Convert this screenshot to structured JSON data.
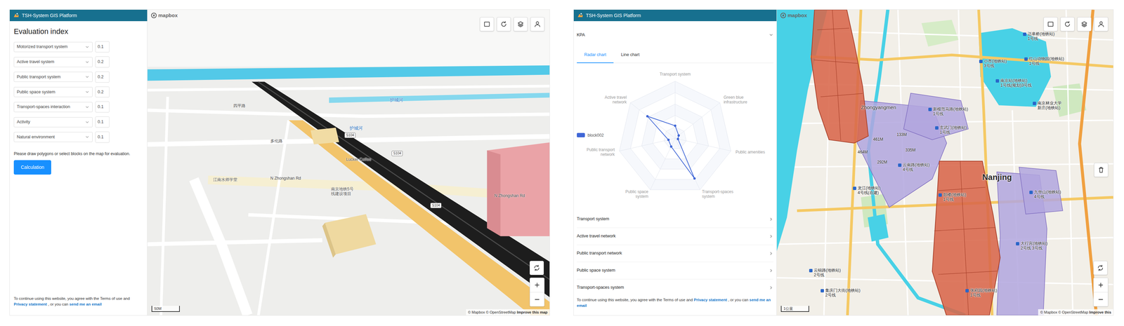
{
  "evaluation_window": {
    "app_title": "TSH-System GIS Platform",
    "sidebar": {
      "heading": "Evaluation index",
      "indexes": [
        {
          "label": "Motorized transport system",
          "weight": "0.1"
        },
        {
          "label": "Active travel system",
          "weight": "0.2"
        },
        {
          "label": "Public transport system",
          "weight": "0.2"
        },
        {
          "label": "Public space system",
          "weight": "0.2"
        },
        {
          "label": "Transport-spaces interaction",
          "weight": "0.1"
        },
        {
          "label": "Activity",
          "weight": "0.1"
        },
        {
          "label": "Natural environment",
          "weight": "0.1"
        }
      ],
      "hint": "Please draw polygons or select blocks on the map for evaluation.",
      "button": "Calculation"
    },
    "footer": {
      "lead": "To continue using this website, you agree with the Terms of use and",
      "privacy": "Privacy statement",
      "middle": ", or you can",
      "email": "send me an email"
    },
    "map": {
      "logo": "mapbox",
      "scale": "50M",
      "attribution": {
        "mapbox": "© Mapbox",
        "osm": "© OpenStreetMap",
        "improve": "Improve this map"
      },
      "labels": [
        {
          "text": "护城河",
          "kind": "water"
        },
        {
          "text": "护城河",
          "kind": "water"
        },
        {
          "text": "四平路",
          "kind": "road"
        },
        {
          "text": "多伦路",
          "kind": "road"
        },
        {
          "text": "N Zhongshan Rd",
          "kind": "road"
        },
        {
          "text": "N Zhongshan Rd",
          "kind": "road"
        },
        {
          "text": "Lucker Coffee",
          "kind": "poi"
        },
        {
          "text": "江南水师学堂",
          "kind": "poi"
        },
        {
          "text": "南京地铁5号\n线建设项目",
          "kind": "poi"
        },
        {
          "text": "S104",
          "kind": "shield"
        },
        {
          "text": "S104",
          "kind": "shield"
        },
        {
          "text": "S104",
          "kind": "shield"
        }
      ]
    }
  },
  "kpa_window": {
    "app_title": "TSH-System GIS Platform",
    "panel": {
      "title": "KPA",
      "expanded": true,
      "tabs": [
        {
          "label": "Radar chart",
          "selected": true
        },
        {
          "label": "Line chart",
          "selected": false
        }
      ],
      "chart": {
        "axes": [
          "Transport system",
          "Green blue infrastructure",
          "Public amenities",
          "Transport-spaces system",
          "Public space system",
          "Public transport network",
          "Active travel network"
        ],
        "series": [
          {
            "name": "block002",
            "color": "#3f66d6",
            "values": [
              0.22,
              0.08,
              0.05,
              0.78,
              0.16,
              0.12,
              0.62
            ]
          }
        ]
      },
      "sections": [
        {
          "label": "Transport system",
          "expanded": false
        },
        {
          "label": "Active travel network",
          "expanded": false
        },
        {
          "label": "Public transport network",
          "expanded": false
        },
        {
          "label": "Public space system",
          "expanded": false
        },
        {
          "label": "Transport-spaces system",
          "expanded": false
        }
      ]
    },
    "footer": {
      "lead": "To continue using this website, you agree with the Terms of use and",
      "privacy": "Privacy statement",
      "middle": ", or you can",
      "email": "send me an email"
    },
    "map": {
      "logo": "mapbox",
      "scale": "1公里",
      "attribution": {
        "mapbox": "© Mapbox",
        "osm": "© OpenStreetMap",
        "improve": "Improve this"
      },
      "labels": [
        {
          "text": "迈皋桥(地铁站)\n1号线",
          "kind": "station"
        },
        {
          "text": "小市(地铁站)\n3号线",
          "kind": "station"
        },
        {
          "text": "红山动物园(地铁站)\n1号线",
          "kind": "station"
        },
        {
          "text": "南京站(地铁站)\n1号线(规划)3号线",
          "kind": "station"
        },
        {
          "text": "南京林业大学\n新庄(地铁站)",
          "kind": "station"
        },
        {
          "text": "新模范马路(地铁站)\n1号线",
          "kind": "station"
        },
        {
          "text": "玄武门(地铁站)\n1号线",
          "kind": "station"
        },
        {
          "text": "Zhongyangmen",
          "kind": "district"
        },
        {
          "text": "云南路(地铁站)\n4号线",
          "kind": "station"
        },
        {
          "text": "鼓楼(地铁站)\n1号线",
          "kind": "station"
        },
        {
          "text": "Nanjing",
          "kind": "city"
        },
        {
          "text": "九华山(地铁站)\n4号线",
          "kind": "station"
        },
        {
          "text": "龙江(地铁站)\n4号线(在建)",
          "kind": "station"
        },
        {
          "text": "大行宫(地铁站)\n2号线 3号线",
          "kind": "station"
        },
        {
          "text": "云锦路(地铁站)\n2号线",
          "kind": "station"
        },
        {
          "text": "集庆门大街(地铁站)\n2号线",
          "kind": "station"
        },
        {
          "text": "张府园(地铁站)\n1号线",
          "kind": "station"
        },
        {
          "text": "133M",
          "kind": "distance"
        },
        {
          "text": "461M",
          "kind": "distance"
        },
        {
          "text": "335M",
          "kind": "distance"
        },
        {
          "text": "464M",
          "kind": "distance"
        },
        {
          "text": "292M",
          "kind": "distance"
        }
      ]
    }
  }
}
